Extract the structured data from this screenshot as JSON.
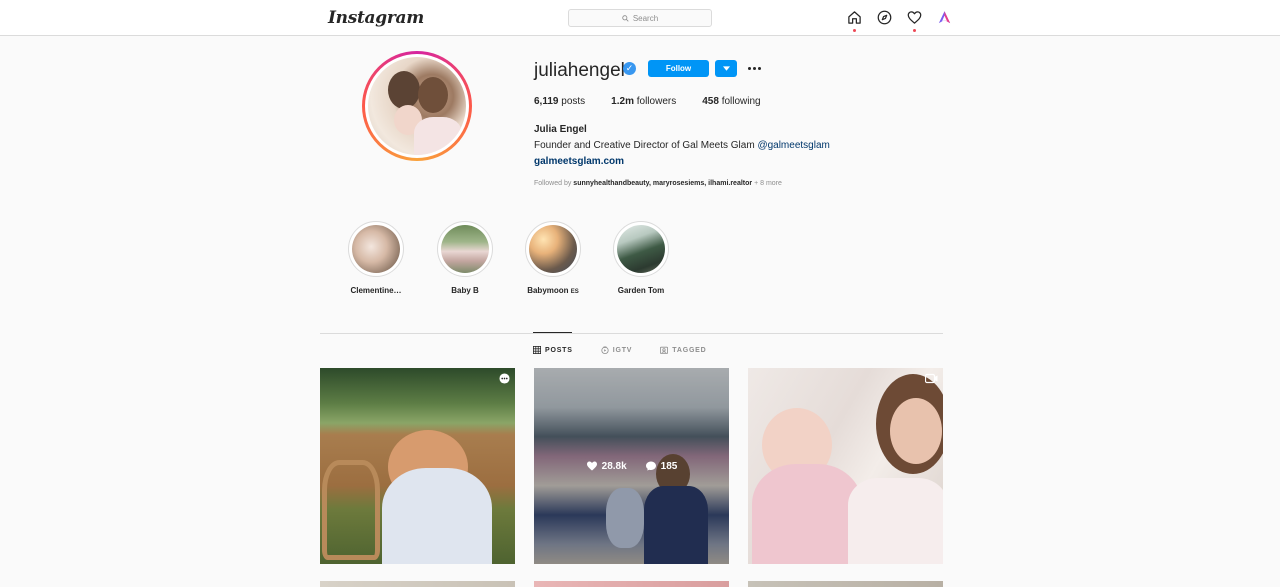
{
  "topbar": {
    "logo": "Instagram",
    "search_placeholder": "Search",
    "icons": [
      "home-icon",
      "explore-icon",
      "activity-heart-icon",
      "profile-icon"
    ]
  },
  "profile": {
    "username": "juliahengel",
    "follow_label": "Follow",
    "stats": {
      "posts_count": "6,119",
      "posts_label": "posts",
      "followers_count": "1.2m",
      "followers_label": "followers",
      "following_count": "458",
      "following_label": "following"
    },
    "full_name": "Julia Engel",
    "bio": "Founder and Creative Director of Gal Meets Glam ",
    "bio_mention": "@galmeetsglam",
    "website": "galmeetsglam.com",
    "followed_by_prefix": "Followed by ",
    "followed_by_names": "sunnyhealthandbeauty, maryrosesiems, ilhami.realtor",
    "followed_by_more": " + 8 more"
  },
  "highlights": [
    {
      "label": "Clementine…"
    },
    {
      "label": "Baby B"
    },
    {
      "label": "Babymoon",
      "suffix": "ES"
    },
    {
      "label": "Garden Tom"
    }
  ],
  "tabs": [
    {
      "label": "POSTS",
      "active": true
    },
    {
      "label": "IGTV",
      "active": false
    },
    {
      "label": "TAGGED",
      "active": false
    }
  ],
  "posts": [
    {
      "type": "carousel"
    },
    {
      "type": "image",
      "hover": true,
      "likes": "28.8k",
      "comments": "185"
    },
    {
      "type": "video"
    }
  ],
  "colors": {
    "accent": "#0095f6",
    "verified": "#3897f0",
    "notification_dot": "#ed4956"
  }
}
